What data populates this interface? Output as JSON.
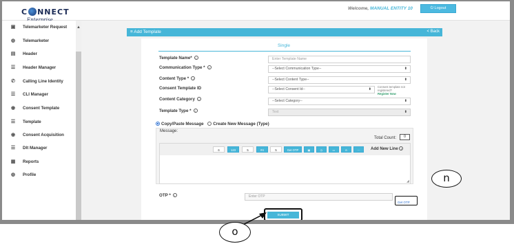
{
  "header": {
    "logo_brand_left": "C",
    "logo_brand_right": "NNECT",
    "logo_subtitle": "Enterprise Solutions",
    "welcome_prefix": "Welcome,",
    "welcome_user": "MANUAL ENTITY 10",
    "logout_label": "Logout"
  },
  "sidebar": {
    "items": [
      {
        "label": "Telemarketer Request",
        "icon": "monitor-icon"
      },
      {
        "label": "Telemarketer",
        "icon": "headset-icon"
      },
      {
        "label": "Header",
        "icon": "header-icon"
      },
      {
        "label": "Header Manager",
        "icon": "list-icon"
      },
      {
        "label": "Calling Line Identity",
        "icon": "phone-icon"
      },
      {
        "label": "CLI Manager",
        "icon": "list-icon"
      },
      {
        "label": "Consent Template",
        "icon": "template-icon"
      },
      {
        "label": "Template",
        "icon": "list-icon"
      },
      {
        "label": "Consent Acquisition",
        "icon": "template-icon"
      },
      {
        "label": "Dlt Manager",
        "icon": "list-icon"
      },
      {
        "label": "Reports",
        "icon": "report-icon"
      },
      {
        "label": "Profile",
        "icon": "user-icon"
      }
    ]
  },
  "panel": {
    "title": "Add Template",
    "back_label": "< Back",
    "tab_label": "Single"
  },
  "form": {
    "template_name": {
      "label": "Template Name*",
      "placeholder": "Enter Template Name"
    },
    "communication_type": {
      "label": "Communication Type *",
      "value": "--Select Communication Type--"
    },
    "content_type": {
      "label": "Content Type *",
      "value": "--Select Content Type--"
    },
    "consent_template_id": {
      "label": "Consent Template ID",
      "value": "--Select Consent Id--"
    },
    "consent_note": {
      "line1": "Consent template not",
      "line2": "registered?",
      "register_link": "Register Now"
    },
    "content_category": {
      "label": "Content Category",
      "value": "--Select Category--"
    },
    "template_type": {
      "label": "Template Type *",
      "value": "Text"
    }
  },
  "message": {
    "radio_copy": "Copy/Paste Message",
    "radio_create": "Create New Message (Type)",
    "label": "Message:",
    "total_count_label": "Total Count:",
    "total_count_value": "0",
    "add_new_line": "Add New Line",
    "toolbar": [
      "6",
      "123",
      "5",
      "#4",
      "5",
      "Get OTP"
    ]
  },
  "otp": {
    "label": "OTP *",
    "placeholder": "Enter OTP",
    "get_otp_label": "Get OTP"
  },
  "submit_label": "SUBMIT",
  "callouts": {
    "n": "n",
    "o": "o"
  },
  "colors": {
    "accent": "#46b6d8",
    "brand": "#1a2a55"
  }
}
